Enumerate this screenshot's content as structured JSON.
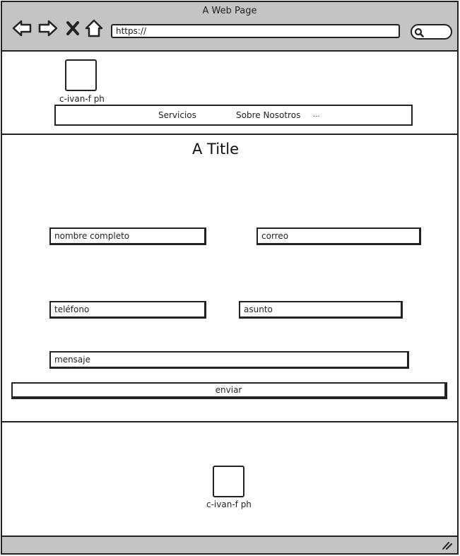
{
  "browser": {
    "window_title": "A Web Page",
    "url": "https://",
    "nav_icons": [
      "back-arrow-icon",
      "forward-arrow-icon",
      "close-x-icon",
      "home-icon"
    ],
    "search_icon": "search-icon"
  },
  "header": {
    "logo_caption": "c-ivan-f ph",
    "menu": [
      {
        "label": "Servicios"
      },
      {
        "label": "Sobre Nosotros"
      },
      {
        "label": "..."
      }
    ]
  },
  "main": {
    "title": "A Title",
    "form": {
      "fullname_placeholder": "nombre completo",
      "email_placeholder": "correo",
      "phone_placeholder": "teléfono",
      "subject_placeholder": "asunto",
      "message_placeholder": "mensaje",
      "submit_label": "enviar"
    }
  },
  "footer": {
    "logo_caption": "c-ivan-f ph"
  },
  "colors": {
    "chrome": "#c4c4c4",
    "stroke": "#222222",
    "background": "#ffffff"
  }
}
